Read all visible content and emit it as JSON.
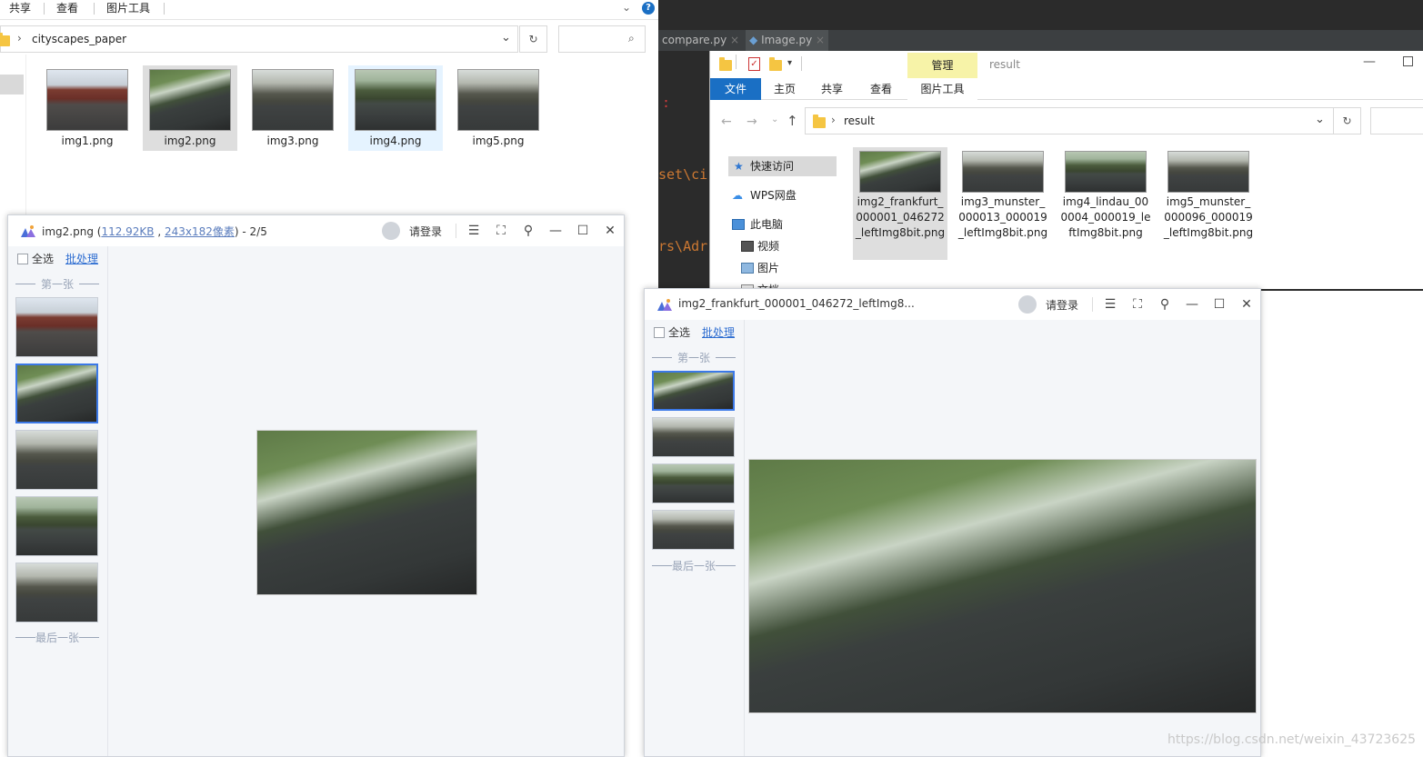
{
  "explorer1": {
    "ribbon_tabs": [
      "共享",
      "查看",
      "图片工具"
    ],
    "address": "cityscapes_paper",
    "files": [
      {
        "name": "img1.png",
        "state": "normal"
      },
      {
        "name": "img2.png",
        "state": "selected"
      },
      {
        "name": "img3.png",
        "state": "normal"
      },
      {
        "name": "img4.png",
        "state": "hover"
      },
      {
        "name": "img5.png",
        "state": "normal"
      }
    ]
  },
  "ide": {
    "tabs": [
      "compare.py",
      "Image.py"
    ],
    "code_fragments": [
      ":",
      "set\\ci",
      "rs\\Adr"
    ]
  },
  "explorer2": {
    "title": "result",
    "manage_label": "管理",
    "tabs": [
      "文件",
      "主页",
      "共享",
      "查看",
      "图片工具"
    ],
    "address": "result",
    "nav": [
      "快速访问",
      "WPS网盘",
      "此电脑",
      "视频",
      "图片",
      "文档"
    ],
    "files": [
      "img2_frankfurt_000001_046272_leftImg8bit.png",
      "img3_munster_000013_000019_leftImg8bit.png",
      "img4_lindau_000004_000019_leftImg8bit.png",
      "img5_munster_000096_000019_leftImg8bit.png"
    ]
  },
  "viewer1": {
    "filename": "img2.png",
    "size": "112.92KB",
    "dims": "243x182像素",
    "position": "- 2/5",
    "login": "请登录",
    "select_all": "全选",
    "batch": "批处理",
    "first_mark": "第一张",
    "last_mark": "最后一张"
  },
  "viewer2": {
    "title": "img2_frankfurt_000001_046272_leftImg8...",
    "login": "请登录",
    "select_all": "全选",
    "batch": "批处理",
    "first_mark": "第一张",
    "last_mark": "最后一张"
  },
  "watermark": "https://blog.csdn.net/weixin_43723625",
  "colors": {
    "accent_blue": "#1a6fc4",
    "manage_yellow": "#f7f3a8",
    "link_blue": "#2f6ed1"
  }
}
